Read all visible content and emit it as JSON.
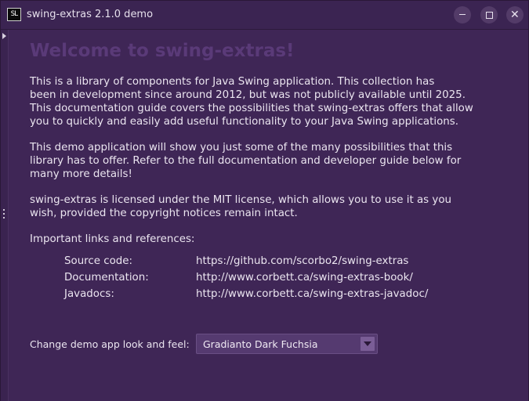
{
  "window": {
    "app_icon_text": "SL",
    "title": "swing-extras 2.1.0 demo"
  },
  "main": {
    "heading": "Welcome to swing-extras!",
    "paragraph1": [
      "This is a library of components for Java Swing application. This collection has",
      "been in development since around 2012, but was not publicly available until 2025.",
      "This documentation guide covers the possibilities that swing-extras offers that allow",
      "you to quickly and easily add useful functionality to your Java Swing applications."
    ],
    "paragraph2": [
      "This demo application will show you just some of the many possibilities that this",
      "library has to offer. Refer to the full documentation and developer guide below for",
      "many more details!"
    ],
    "paragraph3": [
      "swing-extras is licensed under the MIT license, which allows you to use it as you",
      "wish, provided the copyright notices remain intact."
    ],
    "links_intro": "Important links and references:",
    "links": [
      {
        "label": "Source code:",
        "value": "https://github.com/scorbo2/swing-extras"
      },
      {
        "label": "Documentation:",
        "value": "http://www.corbett.ca/swing-extras-book/"
      },
      {
        "label": "Javadocs:",
        "value": "http://www.corbett.ca/swing-extras-javadoc/"
      }
    ],
    "laf_label": "Change demo app look and feel:",
    "laf_selected": "Gradianto Dark Fuchsia"
  },
  "icons": {
    "window_controls": [
      "minimize-icon",
      "maximize-icon",
      "close-icon"
    ],
    "side": [
      "expand-arrow-icon",
      "splitter-grip-icon"
    ],
    "combo": "chevron-down-icon"
  },
  "colors": {
    "background": "#3f2656",
    "heading": "#5a3a78",
    "text": "#ebe5f0",
    "combo_button": "#7a5d96"
  }
}
